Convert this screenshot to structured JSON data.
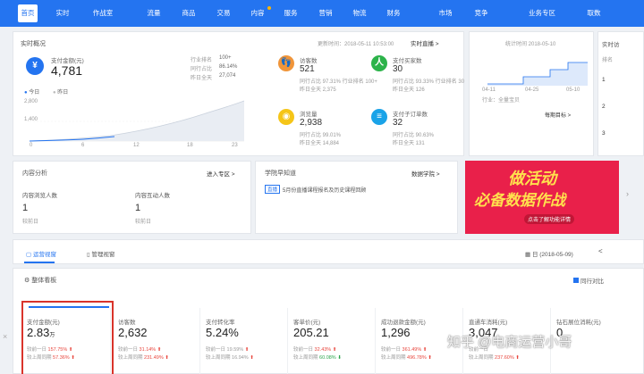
{
  "nav": {
    "items": [
      "首页",
      "实时",
      "作战室",
      "流量",
      "商品",
      "交易",
      "内容",
      "服务",
      "营销",
      "物流",
      "财务",
      "市场",
      "竞争",
      "业务专区",
      "取数"
    ],
    "active_index": 0
  },
  "realtime": {
    "title": "实时概况",
    "update_time": "更新时间：2018-05-11 10:53:00",
    "live_link": "实时直播 >",
    "pay_amount": {
      "label": "支付金额(元)",
      "value": "4,781",
      "rank_label": "行业排名",
      "rank_value": "100+",
      "pct_label": "同行占比",
      "pct_value": "86.14%",
      "yesterday_label": "昨日全天",
      "yesterday_value": "27,074"
    },
    "legend_today": "今日",
    "legend_yesterday": "昨日",
    "y_ticks": [
      "2,800",
      "1,400",
      "0"
    ],
    "x_ticks": [
      "0",
      "6",
      "12",
      "18",
      "23"
    ],
    "metrics": [
      {
        "label": "访客数",
        "value": "521",
        "line1": "同行占比  97.31% 行业排名 100+",
        "line2": "昨日全天  2,375",
        "color": "#f0953a",
        "icon": "footprint-icon"
      },
      {
        "label": "支付买家数",
        "value": "30",
        "line1": "同行占比  93.33% 行业排名 30",
        "line2": "昨日全天  126",
        "color": "#2cb34a",
        "icon": "buyer-icon"
      },
      {
        "label": "浏览量",
        "value": "2,938",
        "line1": "同行占比  99.01%",
        "line2": "昨日全天  14,884",
        "color": "#f5c518",
        "icon": "eye-icon"
      },
      {
        "label": "支付子订单数",
        "value": "32",
        "line1": "同行占比  90.63%",
        "line2": "昨日全天  131",
        "color": "#1aa3e8",
        "icon": "order-icon"
      }
    ]
  },
  "right_panel": {
    "date": "统计时间 2018-05-10",
    "x_labels": [
      "04-11",
      "04-25",
      "05-10"
    ],
    "footer": "行业：全量宝贝",
    "link": "每期目标 >"
  },
  "far_right": {
    "title": "实时访",
    "header": "排名",
    "ranks": [
      "1",
      "2",
      "3"
    ]
  },
  "content": {
    "title": "内容分析",
    "link": "进入专区 >",
    "cols": [
      {
        "label": "内容浏览人数",
        "value": "1",
        "sub": "较前日"
      },
      {
        "label": "内容互动人数",
        "value": "1",
        "sub": "较前日"
      }
    ]
  },
  "school": {
    "title": "学院早知道",
    "link": "数据学院 >",
    "tag": "直播",
    "text": "5月份直播课程报名及历史课程回顾"
  },
  "banner": {
    "line1": "做活动",
    "line2": "必备数据作战",
    "button": "点击了解功能详情"
  },
  "tabs": {
    "items": [
      "运营视窗",
      "管理视窗"
    ],
    "date": "日 (2018-05-09)",
    "arrow": "<"
  },
  "overview": {
    "title": "整体看板",
    "compare": "同行对比"
  },
  "kpis": [
    {
      "label": "支付金额(元)",
      "value": "2.83",
      "unit": "万",
      "l1": "较前一日",
      "v1": "157.75%",
      "l2": "较上周同期",
      "v2": "57.36%",
      "c1": "red",
      "c2": "red"
    },
    {
      "label": "访客数",
      "value": "2,632",
      "unit": "",
      "l1": "较前一日",
      "v1": "31.14%",
      "l2": "较上周同期",
      "v2": "231.49%",
      "c1": "red",
      "c2": "red"
    },
    {
      "label": "支付转化率",
      "value": "5.24%",
      "unit": "",
      "l1": "较前一日",
      "v1": "19.59%",
      "l2": "较上周同期",
      "v2": "16.94%",
      "c1": "red",
      "c2": "red"
    },
    {
      "label": "客单价(元)",
      "value": "205.21",
      "unit": "",
      "l1": "较前一日",
      "v1": "32.43%",
      "l2": "较上周同期",
      "v2": "60.08%",
      "c1": "red",
      "c2": "green"
    },
    {
      "label": "成功退款金额(元)",
      "value": "1,296",
      "unit": "",
      "l1": "较前一日",
      "v1": "361.49%",
      "l2": "较上周同期",
      "v2": "496.78%",
      "c1": "red",
      "c2": "red"
    },
    {
      "label": "直通车消耗(元)",
      "value": "3,047",
      "unit": "",
      "l1": "较前一日",
      "v1": "",
      "l2": "较上周同期",
      "v2": "237.60%",
      "c1": "red",
      "c2": "red"
    },
    {
      "label": "钻石展位消耗(元)",
      "value": "0",
      "unit": "",
      "l1": "",
      "v1": "",
      "l2": "",
      "v2": "",
      "c1": "red",
      "c2": "red"
    }
  ],
  "watermark": "知乎 @电商运营小哥",
  "colors": {
    "primary": "#2474f0",
    "highlight_box": "#d9342b",
    "banner_bg": "#e9204a"
  }
}
